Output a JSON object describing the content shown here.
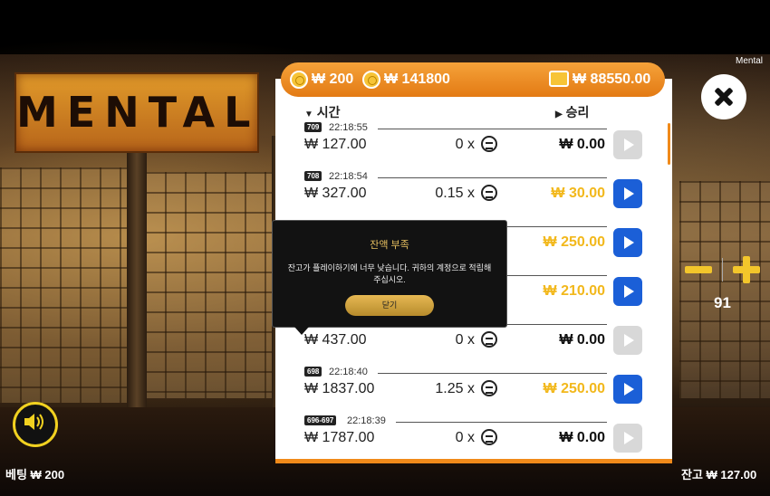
{
  "game": {
    "name": "Mental",
    "logo_text": "MENTAL"
  },
  "topbar": {
    "bet_coin": "₩ 200",
    "total_coin": "₩ 141800",
    "wallet": "₩ 88550.00"
  },
  "list_header": {
    "time_label": "시간",
    "win_label": "승리"
  },
  "rows": [
    {
      "id": "709",
      "time": "22:18:55",
      "bet": "₩ 127.00",
      "mult": "0 x",
      "win": "₩ 0.00",
      "highlight": false,
      "replay": false
    },
    {
      "id": "708",
      "time": "22:18:54",
      "bet": "₩ 327.00",
      "mult": "0.15 x",
      "win": "₩ 30.00",
      "highlight": true,
      "replay": true
    },
    {
      "id": "",
      "time": "",
      "bet": "",
      "mult": "",
      "win": "₩ 250.00",
      "highlight": true,
      "replay": true
    },
    {
      "id": "",
      "time": "",
      "bet": "",
      "mult": "",
      "win": "₩ 210.00",
      "highlight": true,
      "replay": true
    },
    {
      "id": "",
      "time": "",
      "bet": "₩ 437.00",
      "mult": "0 x",
      "win": "₩ 0.00",
      "highlight": false,
      "replay": false
    },
    {
      "id": "698",
      "time": "22:18:40",
      "bet": "₩ 1837.00",
      "mult": "1.25 x",
      "win": "₩ 250.00",
      "highlight": true,
      "replay": true
    },
    {
      "id": "696-697",
      "time": "22:18:39",
      "bet": "₩ 1787.00",
      "mult": "0 x",
      "win": "₩ 0.00",
      "highlight": false,
      "replay": false
    }
  ],
  "modal": {
    "title": "잔액 부족",
    "body": "잔고가 플레이하기에 너무 낮습니다. 귀하의 계정으로 적립해 주십시오.",
    "button": "닫기"
  },
  "controls": {
    "level": "91"
  },
  "footer": {
    "bet": "베팅 ₩ 200",
    "balance": "잔고 ₩ 127.00"
  },
  "colors": {
    "accent": "#f08a1a",
    "play": "#1b5fd7",
    "win_highlight": "#f2b81c",
    "modal_title": "#e8c060"
  },
  "icons": [
    "coin-icon",
    "wallet-icon",
    "close-icon",
    "sound-icon",
    "play-icon",
    "sort-down-icon",
    "sort-right-icon"
  ]
}
